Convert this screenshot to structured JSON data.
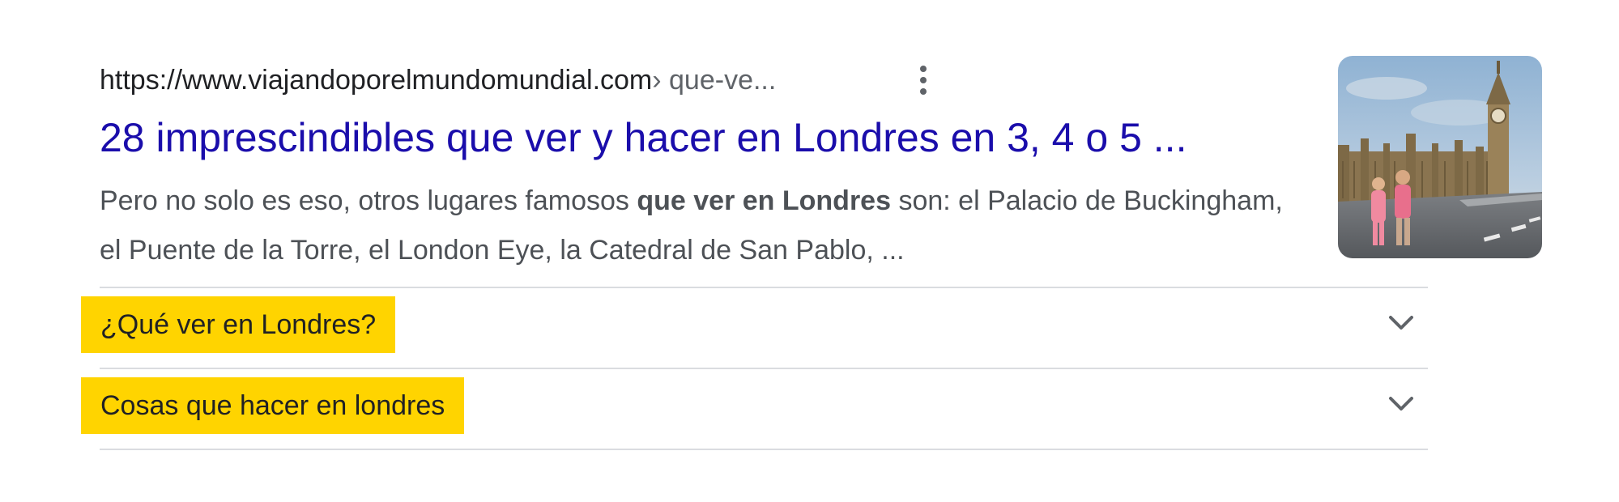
{
  "result": {
    "url_domain": "https://www.viajandoporelmundomundial.com",
    "url_path": " › que-ve...",
    "more_icon": "three-dots-vertical-icon",
    "title": "28 imprescindibles que ver y hacer en Londres en 3, 4 o 5 ...",
    "snippet": {
      "part1": "Pero no solo es eso, otros lugares famosos ",
      "bold": "que ver en Londres",
      "part2": " son: el Palacio de Buckingham, el Puente de la Torre, el London Eye, la Catedral de San Pablo, ..."
    },
    "thumbnail_alt": "Big Ben and Parliament thumbnail"
  },
  "faqs": [
    {
      "label": "¿Qué ver en Londres?",
      "icon": "chevron-down-icon"
    },
    {
      "label": "Cosas que hacer en londres",
      "icon": "chevron-down-icon"
    }
  ],
  "colors": {
    "link": "#1a0dab",
    "highlight": "#ffd400",
    "text": "#202124",
    "snippet": "#4d5156",
    "divider": "#dadce0"
  }
}
